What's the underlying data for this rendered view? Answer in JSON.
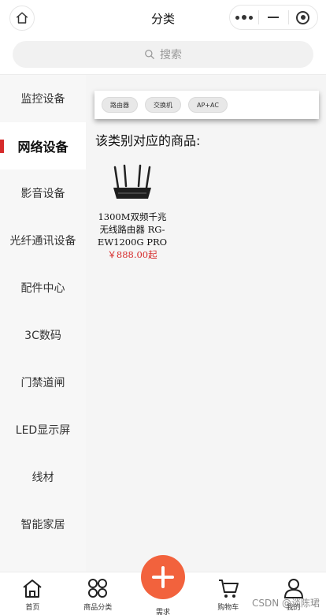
{
  "header": {
    "title": "分类",
    "home_icon": "home-icon",
    "capsule_icons": [
      "more-dots-icon",
      "minus-icon",
      "target-icon"
    ]
  },
  "search": {
    "placeholder": "搜索",
    "icon": "search-icon"
  },
  "sidebar": {
    "active_index": 1,
    "items": [
      {
        "label": "监控设备"
      },
      {
        "label": "网络设备"
      },
      {
        "label": "影音设备"
      },
      {
        "label": "光纤通讯设备"
      },
      {
        "label": "配件中心"
      },
      {
        "label": "3C数码"
      },
      {
        "label": "门禁道闸"
      },
      {
        "label": "LED显示屏"
      },
      {
        "label": "线材"
      },
      {
        "label": "智能家居"
      }
    ]
  },
  "tags": [
    {
      "label": "路由器"
    },
    {
      "label": "交换机"
    },
    {
      "label": "AP+AC"
    }
  ],
  "section_title": "该类别对应的商品:",
  "products": [
    {
      "name": "1300M双频千兆无线路由器 RG-EW1200G PRO",
      "price": "￥888.00起",
      "image": "router-image"
    }
  ],
  "tabbar": {
    "items": [
      {
        "label": "首页",
        "icon": "home-icon"
      },
      {
        "label": "商品分类",
        "icon": "category-icon"
      },
      {
        "label": "需求",
        "icon": "plus-icon"
      },
      {
        "label": "购物车",
        "icon": "cart-icon"
      },
      {
        "label": "我的",
        "icon": "user-icon"
      }
    ]
  },
  "watermark": "CSDN @谈陈珺",
  "colors": {
    "accent_red": "#d62b2b",
    "plus_button": "#f2623d"
  }
}
